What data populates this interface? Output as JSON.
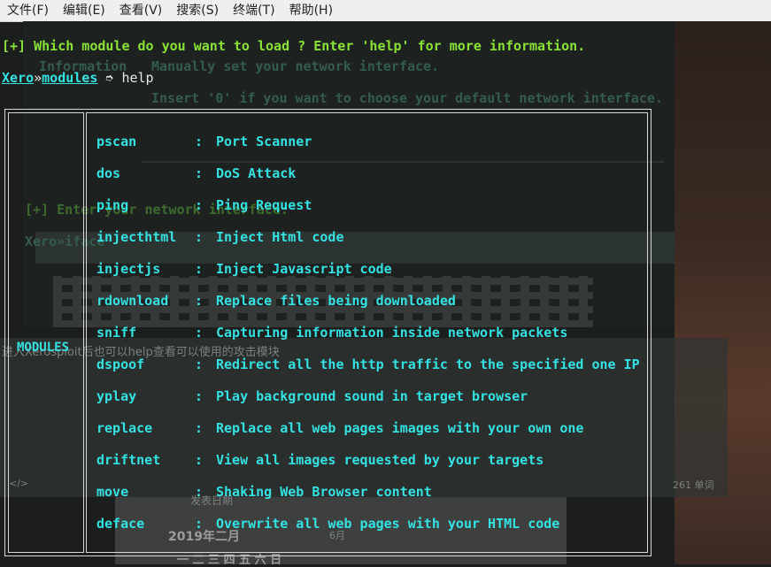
{
  "menubar": {
    "items": [
      "文件(F)",
      "编辑(E)",
      "查看(V)",
      "搜索(S)",
      "终端(T)",
      "帮助(H)"
    ]
  },
  "background": {
    "ghost_information": "Information",
    "ghost_manual": "Manually set your network interface.",
    "ghost_insert": "Insert '0' if you want to choose your default network interface.",
    "ghost_enter": "[+] Enter your network interface:",
    "ghost_prompt": "Xero»iface",
    "ghost_chinese": "进入Xerosploit后也可以help查看可以使用的攻击模块",
    "ghost_wordcount": "261 单词",
    "ghost_publish": "发表日期",
    "ghost_month": "2019年二月",
    "ghost_month2": "6月",
    "ghost_weekdays": "一  二  三  四  五  六  日",
    "ghost_tag": "</>"
  },
  "terminal": {
    "question": "[+] Which module do you want to load ? Enter 'help' for more information.",
    "prompt_host": "Xero",
    "prompt_sep": "»",
    "prompt_module": "modules",
    "prompt_arrow": " ➮ ",
    "command": "help"
  },
  "modules_table": {
    "header": "MODULES",
    "colon": ":",
    "rows": [
      {
        "name": "pscan",
        "desc": "Port Scanner"
      },
      {
        "name": "dos",
        "desc": "DoS Attack"
      },
      {
        "name": "ping",
        "desc": "Ping Request"
      },
      {
        "name": "injecthtml",
        "desc": "Inject Html code"
      },
      {
        "name": "injectjs",
        "desc": "Inject Javascript code"
      },
      {
        "name": "rdownload",
        "desc": "Replace files being downloaded"
      },
      {
        "name": "sniff",
        "desc": "Capturing information inside network packets"
      },
      {
        "name": "dspoof",
        "desc": "Redirect all the http traffic to the specified one IP"
      },
      {
        "name": "yplay",
        "desc": "Play background sound in target browser"
      },
      {
        "name": "replace",
        "desc": "Replace all web pages images with your own one"
      },
      {
        "name": "driftnet",
        "desc": "View all images requested by your targets"
      },
      {
        "name": "move",
        "desc": "Shaking Web Browser content"
      },
      {
        "name": "deface",
        "desc": "Overwrite all web pages with your HTML code"
      }
    ]
  },
  "colors": {
    "prompt_green": "#8ae234",
    "module_cyan": "#34e2e2",
    "terminal_bg": "#1b1e1d"
  }
}
